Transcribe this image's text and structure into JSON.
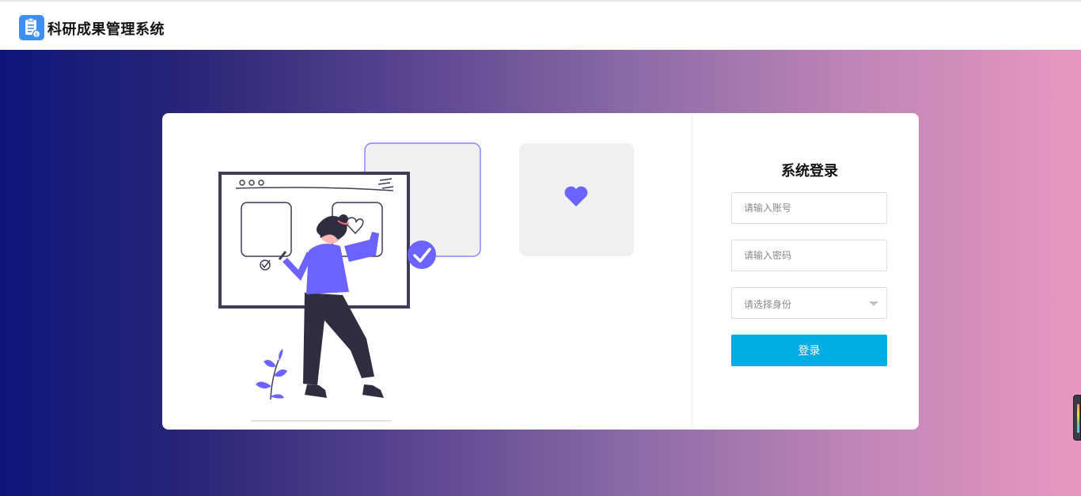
{
  "header": {
    "title": "科研成果管理系统",
    "logo_icon": "clipboard-document-icon",
    "logo_color": "#3d8ff5"
  },
  "login": {
    "title": "系统登录",
    "account_placeholder": "请输入账号",
    "password_placeholder": "请输入密码",
    "role_placeholder": "请选择身份",
    "submit_label": "登录",
    "button_color": "#00ade3"
  },
  "illustration": {
    "accent_color": "#6c63ff",
    "icons": [
      "check-circle-icon",
      "heart-icon",
      "plant-icon"
    ]
  }
}
